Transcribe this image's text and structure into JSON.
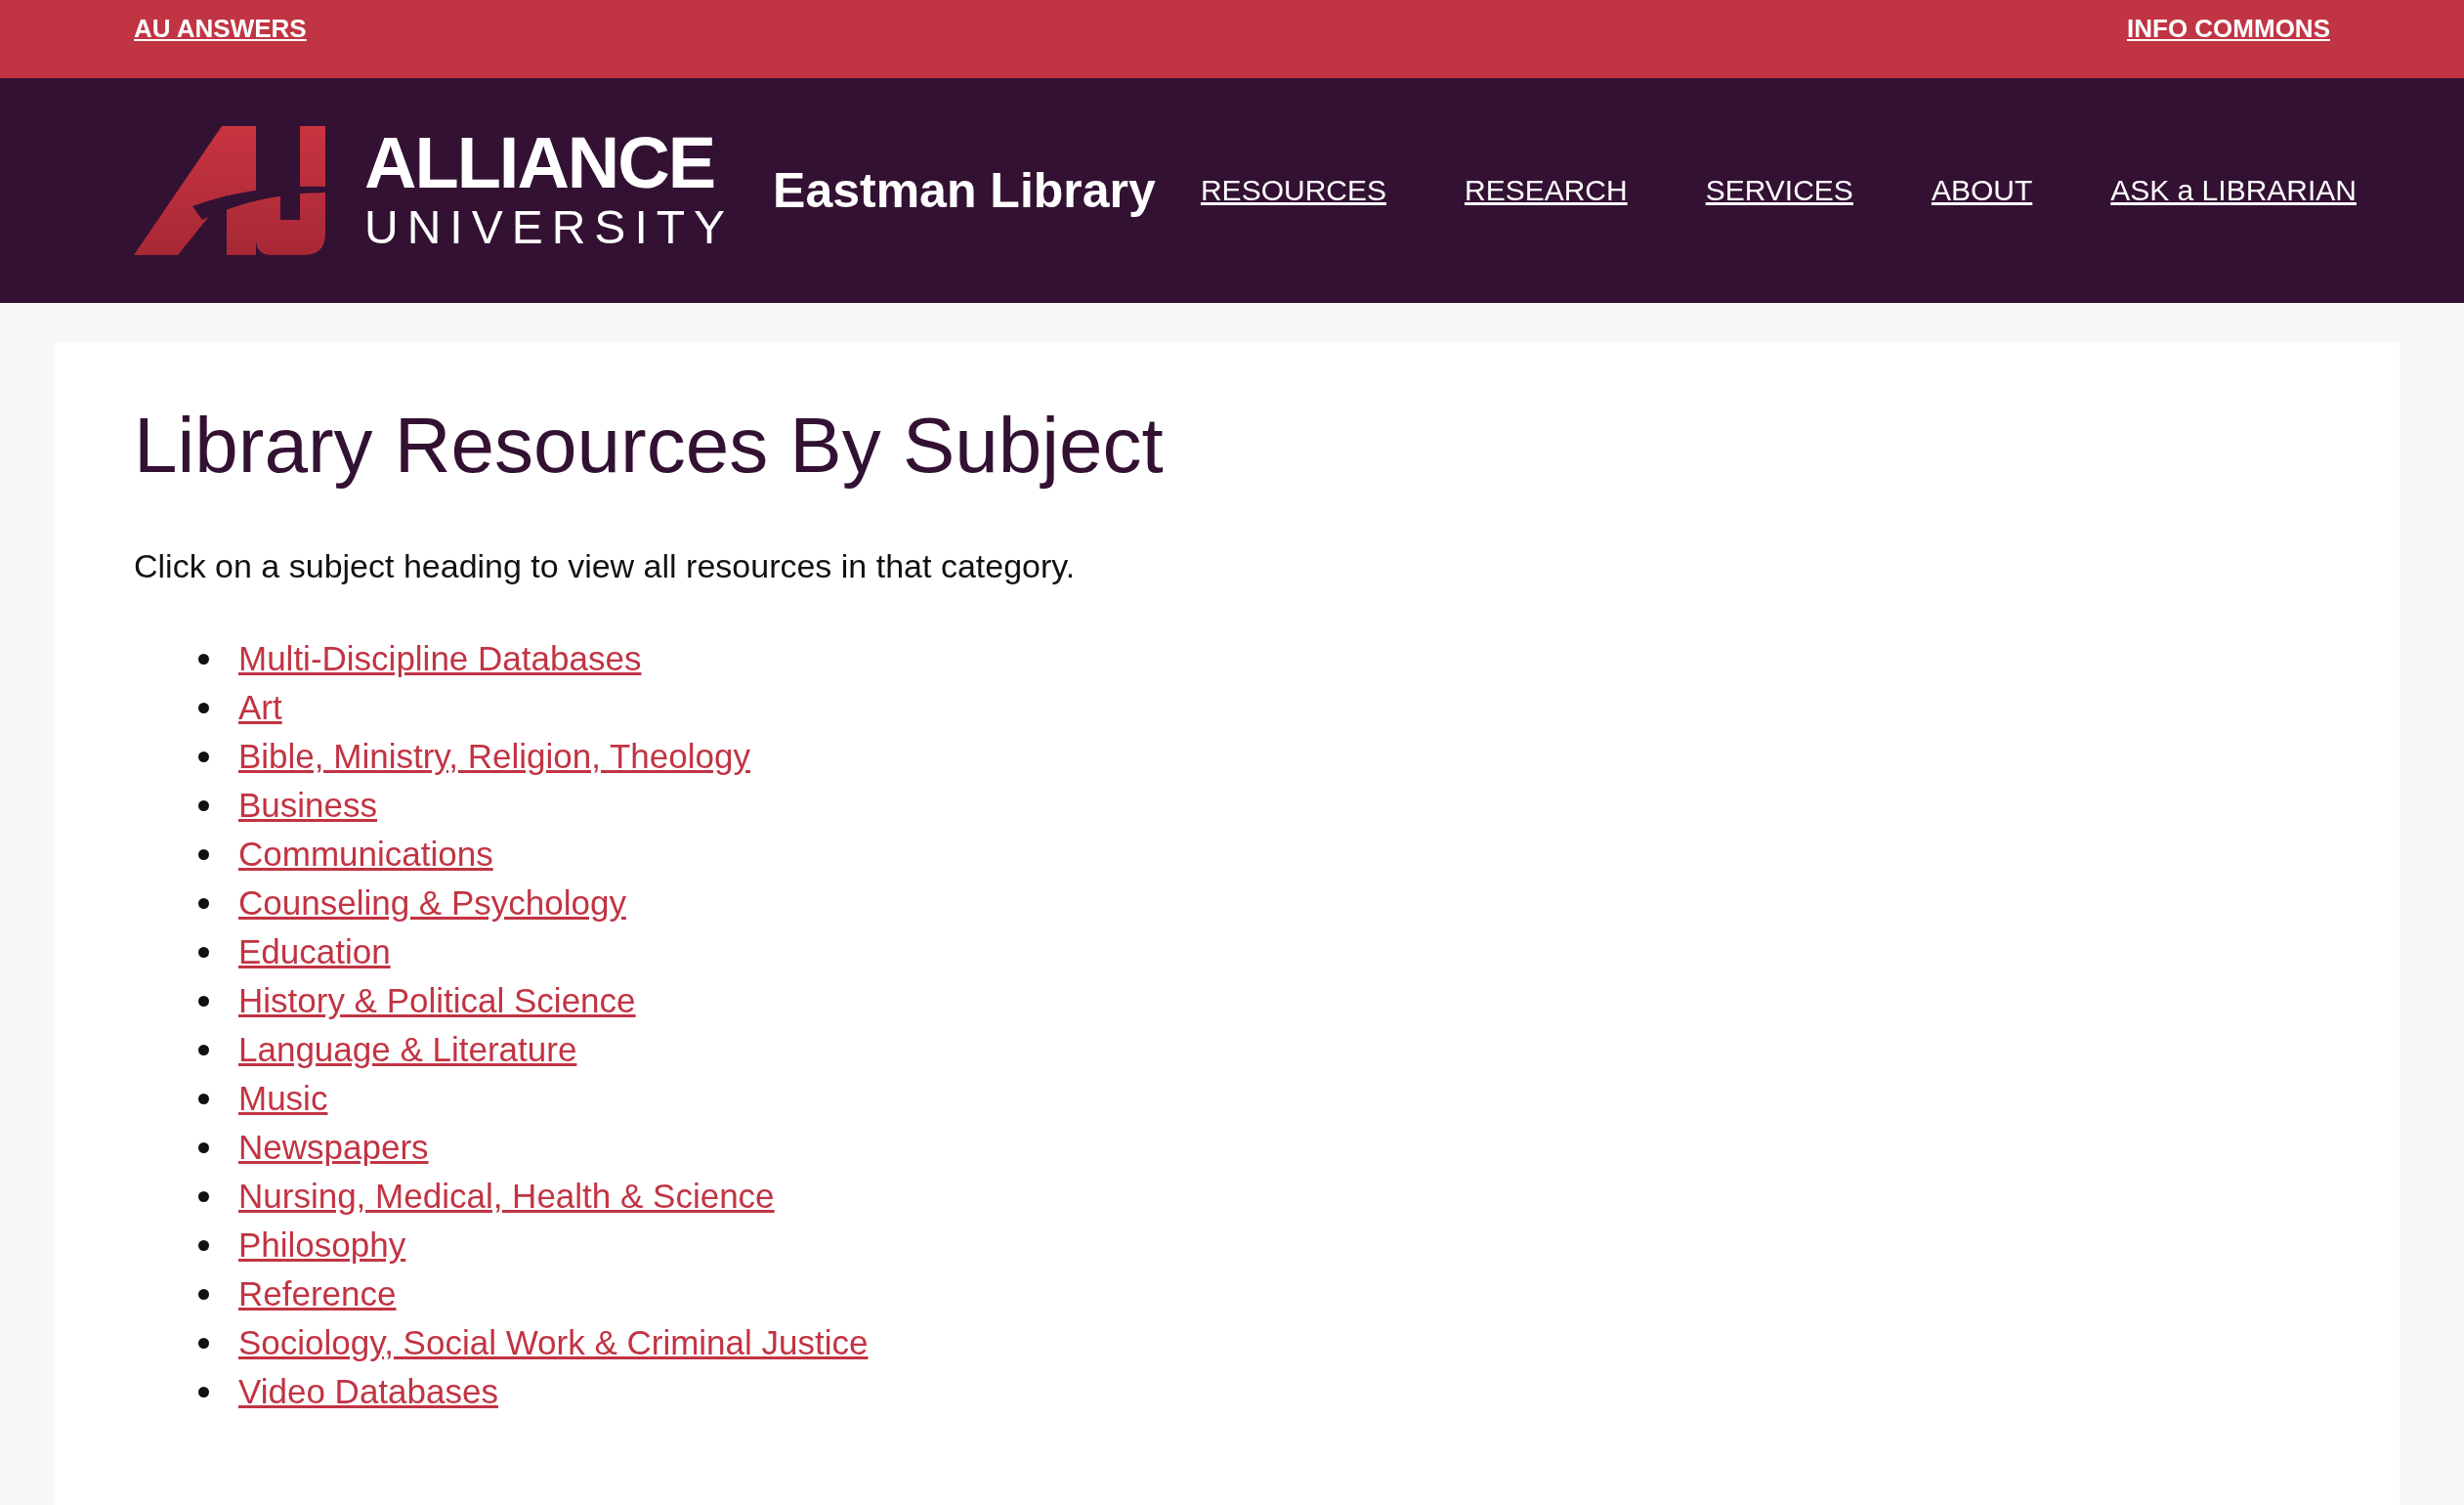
{
  "top_bar": {
    "left_link": "AU ANSWERS",
    "right_link": "INFO COMMONS"
  },
  "header": {
    "logo": {
      "line_1": "ALLIANCE",
      "line_2": "UNIVERSITY"
    },
    "site_title": "Eastman Library",
    "nav": [
      "RESOURCES",
      "RESEARCH",
      "SERVICES",
      "ABOUT",
      "ASK a LIBRARIAN"
    ]
  },
  "content": {
    "title": "Library Resources By Subject",
    "intro": "Click on a subject heading to view all resources in that category.",
    "subjects": [
      "Multi-Discipline Databases",
      "Art",
      "Bible, Ministry, Religion, Theology",
      "Business",
      "Communications",
      "Counseling & Psychology",
      "Education",
      "History & Political Science",
      "Language & Literature",
      "Music",
      "Newspapers",
      "Nursing, Medical, Health & Science",
      "Philosophy",
      "Reference",
      "Sociology, Social Work & Criminal Justice",
      "Video Databases"
    ]
  }
}
